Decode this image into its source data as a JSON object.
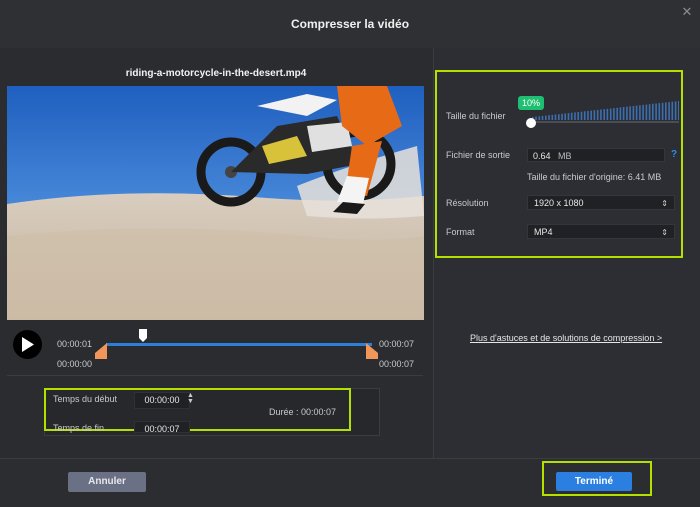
{
  "dialog": {
    "title": "Compresser la vidéo"
  },
  "video": {
    "filename": "riding-a-motorcycle-in-the-desert.mp4"
  },
  "timeline": {
    "current_time": "00:00:01",
    "end_time": "00:00:07",
    "start_marker": "00:00:00",
    "end_marker": "00:00:07",
    "playhead_fraction": 0.14
  },
  "trim": {
    "start_label": "Temps du début",
    "start_value": "00:00:00",
    "end_label": "Temps de fin",
    "end_value": "00:00:07",
    "duration_label": "Durée : 00:00:07"
  },
  "settings": {
    "file_size_label": "Taille du fichier",
    "file_size_percent": "10%",
    "file_size_fraction": 0.1,
    "output_label": "Fichier de sortie",
    "output_value": "0.64",
    "output_unit": "MB",
    "original_size": "Taille du fichier d'origine: 6.41 MB",
    "resolution_label": "Résolution",
    "resolution_value": "1920 x 1080",
    "format_label": "Format",
    "format_value": "MP4",
    "tips_link": "Plus d'astuces et de solutions de compression >"
  },
  "buttons": {
    "cancel": "Annuler",
    "done": "Terminé"
  },
  "colors": {
    "highlight": "#b4e000",
    "accent": "#2b7fe0",
    "badge": "#1fbf72"
  }
}
